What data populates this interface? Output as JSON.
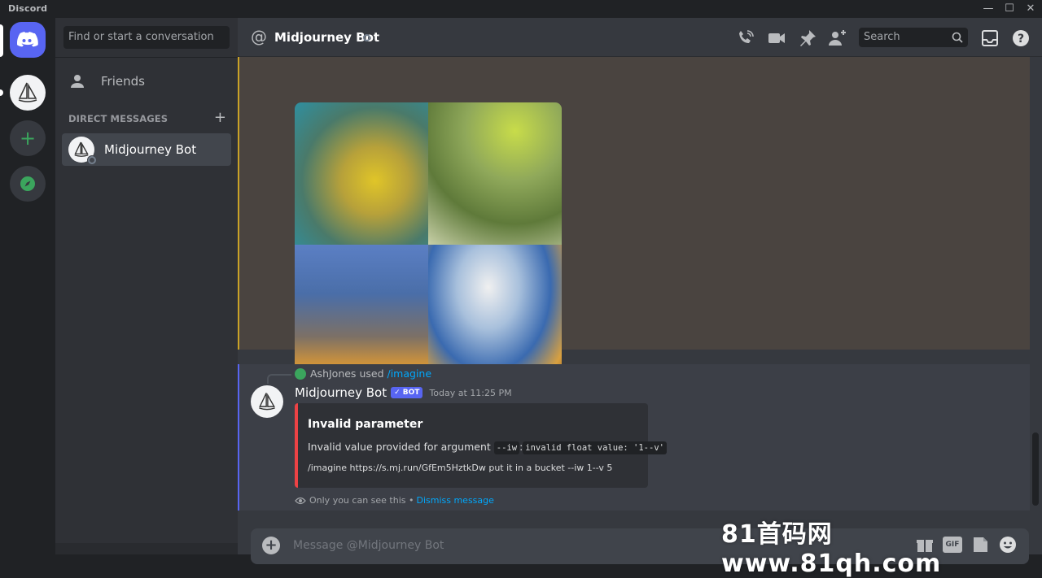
{
  "titlebar": {
    "app_name": "Discord",
    "minimize": "—",
    "maximize": "☐",
    "close": "✕"
  },
  "sidebar": {
    "search_placeholder": "Find or start a conversation",
    "friends_label": "Friends",
    "direct_messages_header": "DIRECT MESSAGES",
    "add_dm": "+",
    "dm_items": [
      {
        "label": "Midjourney Bot",
        "status": "offline"
      }
    ]
  },
  "header": {
    "at_symbol": "@",
    "channel_title": "Midjourney Bot",
    "search_placeholder": "Search"
  },
  "messages": {
    "image_grid_colors": [
      "#b7a13a",
      "#8fa85a",
      "#4a6ea8",
      "#7aa0c8"
    ],
    "reply": {
      "user": "AshJones",
      "verb": "used",
      "command": "/imagine"
    },
    "author": "Midjourney Bot",
    "bot_badge": "✓ BOT",
    "timestamp": "Today at 11:25 PM",
    "embed": {
      "title": "Invalid parameter",
      "desc_prefix": "Invalid value provided for argument",
      "arg_code": "--iw",
      "error_code": "invalid float value: '1--v'",
      "prompt": "/imagine https://s.mj.run/GfEm5HztkDw put it in a bucket --iw 1--v 5"
    },
    "ephemeral_note": "Only you can see this •",
    "dismiss_link": "Dismiss message"
  },
  "composer": {
    "placeholder": "Message @Midjourney Bot",
    "gif_label": "GIF"
  },
  "watermark": "81首码网www.81qh.com",
  "colors": {
    "blurple": "#5865f2",
    "error_red": "#ed4245",
    "link": "#00a8fc",
    "highlight_bar": "#c9a227"
  }
}
